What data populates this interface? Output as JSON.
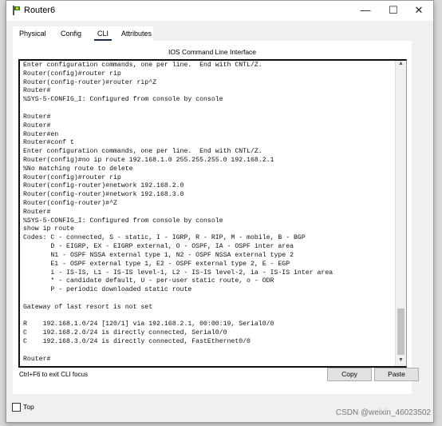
{
  "window": {
    "title": "Router6",
    "minimize": "—",
    "maximize": "☐",
    "close": "✕"
  },
  "tabs": [
    {
      "label": "Physical"
    },
    {
      "label": "Config"
    },
    {
      "label": "CLI",
      "active": true
    },
    {
      "label": "Attributes"
    }
  ],
  "panel": {
    "title": "IOS Command Line Interface"
  },
  "terminal": {
    "lines": [
      "Enter configuration commands, one per line.  End with CNTL/Z.",
      "Router(config)#router rip",
      "Router(config-router)#router rip^Z",
      "Router#",
      "%SYS-5-CONFIG_I: Configured from console by console",
      "",
      "Router#",
      "Router#",
      "Router#en",
      "Router#conf t",
      "Enter configuration commands, one per line.  End with CNTL/Z.",
      "Router(config)#no ip route 192.168.1.0 255.255.255.0 192.168.2.1",
      "%No matching route to delete",
      "Router(config)#router rip",
      "Router(config-router)#network 192.168.2.0",
      "Router(config-router)#network 192.168.3.0",
      "Router(config-router)#^Z",
      "Router#",
      "%SYS-5-CONFIG_I: Configured from console by console",
      "show ip route",
      "Codes: C - connected, S - static, I - IGRP, R - RIP, M - mobile, B - BGP",
      "       D - EIGRP, EX - EIGRP external, O - OSPF, IA - OSPF inter area",
      "       N1 - OSPF NSSA external type 1, N2 - OSPF NSSA external type 2",
      "       E1 - OSPF external type 1, E2 - OSPF external type 2, E - EGP",
      "       i - IS-IS, L1 - IS-IS level-1, L2 - IS-IS level-2, ia - IS-IS inter area",
      "       * - candidate default, U - per-user static route, o - ODR",
      "       P - periodic downloaded static route",
      "",
      "Gateway of last resort is not set",
      "",
      "R    192.168.1.0/24 [120/1] via 192.168.2.1, 00:00:19, Serial0/0",
      "C    192.168.2.0/24 is directly connected, Serial0/0",
      "C    192.168.3.0/24 is directly connected, FastEthernet0/0",
      "",
      "Router#"
    ]
  },
  "footer": {
    "hint": "Ctrl+F6 to exit CLI focus",
    "copy": "Copy",
    "paste": "Paste",
    "top_label": "Top",
    "top_checked": false
  },
  "watermark": "CSDN @weixin_46023502"
}
